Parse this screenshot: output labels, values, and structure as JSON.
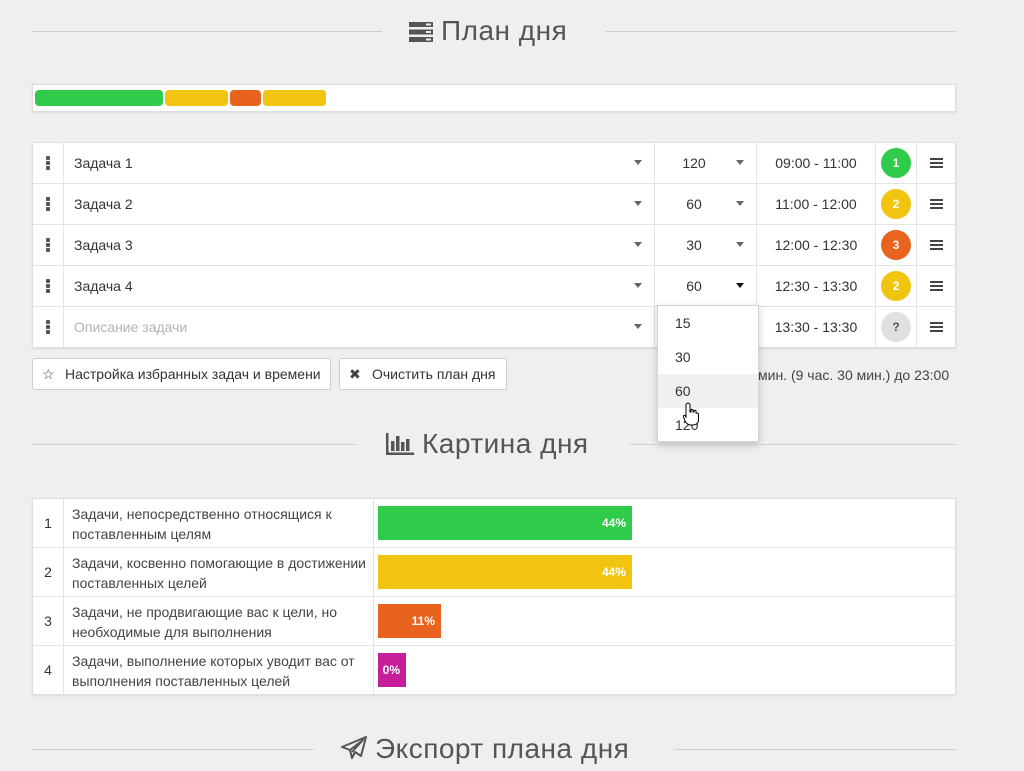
{
  "plan_section": {
    "title": "План дня",
    "icon": "server-icon"
  },
  "progress": {
    "segments": [
      {
        "color": "#2ecc4a",
        "minutes": 120
      },
      {
        "color": "#f1c40f",
        "minutes": 60
      },
      {
        "color": "#e8641e",
        "minutes": 30
      },
      {
        "color": "#f1c40f",
        "minutes": 60
      }
    ]
  },
  "plan_rows": [
    {
      "task": "Задача 1",
      "duration": "120",
      "time": "09:00 - 11:00",
      "badge": "1",
      "badge_color": "#2ecc4a"
    },
    {
      "task": "Задача 2",
      "duration": "60",
      "time": "11:00 - 12:00",
      "badge": "2",
      "badge_color": "#f1c40f"
    },
    {
      "task": "Задача 3",
      "duration": "30",
      "time": "12:00 - 12:30",
      "badge": "3",
      "badge_color": "#e8641e"
    },
    {
      "task": "Задача 4",
      "duration": "60",
      "time": "12:30 - 13:30",
      "badge": "2",
      "badge_color": "#f1c40f"
    }
  ],
  "new_row": {
    "placeholder": "Описание задачи",
    "time": "13:30 - 13:30",
    "badge": "?"
  },
  "buttons": {
    "favorites": "Настройка избранных задач и времени",
    "clear": "Очистить план дня"
  },
  "info_text": "мин. (9 час. 30 мин.) до 23:00",
  "duration_dropdown": {
    "options": [
      "15",
      "30",
      "60",
      "120"
    ],
    "highlighted": "60"
  },
  "picture_section": {
    "title": "Картина дня",
    "icon": "bar-chart-icon"
  },
  "categories": [
    {
      "num": "1",
      "desc": "Задачи, непосредственно относящися к поставленным целям",
      "percent": 44,
      "label": "44%",
      "color": "#2ecc4a"
    },
    {
      "num": "2",
      "desc": "Задачи, косвенно помогающие в достижении поставленных целей",
      "percent": 44,
      "label": "44%",
      "color": "#f1c40f"
    },
    {
      "num": "3",
      "desc": "Задачи, не продвигающие вас к цели, но необходимые для выполнения",
      "percent": 11,
      "label": "11%",
      "color": "#e8641e"
    },
    {
      "num": "4",
      "desc": "Задачи, выполнение которых уводит вас от выполнения поставленных целей",
      "percent": 0,
      "label": "0%",
      "color": "#c71e9a"
    }
  ],
  "export_section": {
    "title": "Экспорт плана дня",
    "icon": "paper-plane-icon"
  }
}
